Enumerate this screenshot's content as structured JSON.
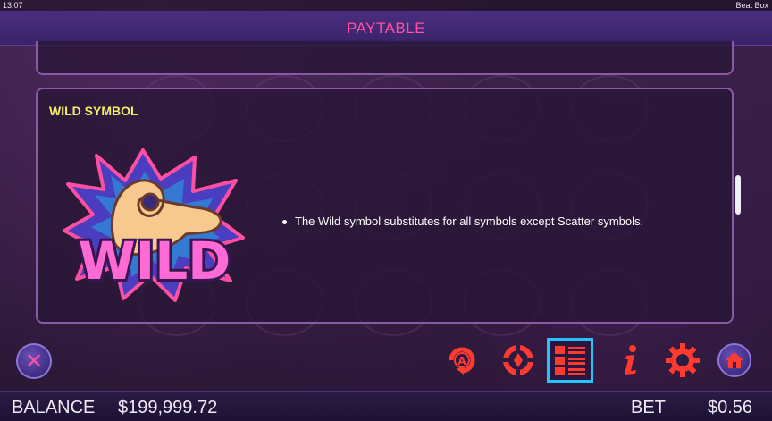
{
  "status_bar": {
    "time": "13:07",
    "game_name": "Beat Box"
  },
  "header": {
    "title": "PAYTABLE"
  },
  "wild_section": {
    "title": "WILD SYMBOL",
    "symbol_text": "WILD",
    "rules": [
      "The Wild symbol substitutes for all symbols except Scatter symbols."
    ]
  },
  "toolbar": {
    "close": "close-icon",
    "icons": [
      "autoplay-icon",
      "chip-icon",
      "paytable-icon",
      "info-icon",
      "settings-icon",
      "home-icon"
    ],
    "active": "paytable-icon"
  },
  "footer": {
    "balance_label": "BALANCE",
    "balance_value": "$199,999.72",
    "bet_label": "BET",
    "bet_value": "$0.56"
  },
  "colors": {
    "title_pink": "#ff4fa3",
    "section_yellow": "#f4ef6a",
    "active_blue": "#24c3ff",
    "icon_red": "#ff3b30",
    "panel_border": "#8a5aa8"
  }
}
